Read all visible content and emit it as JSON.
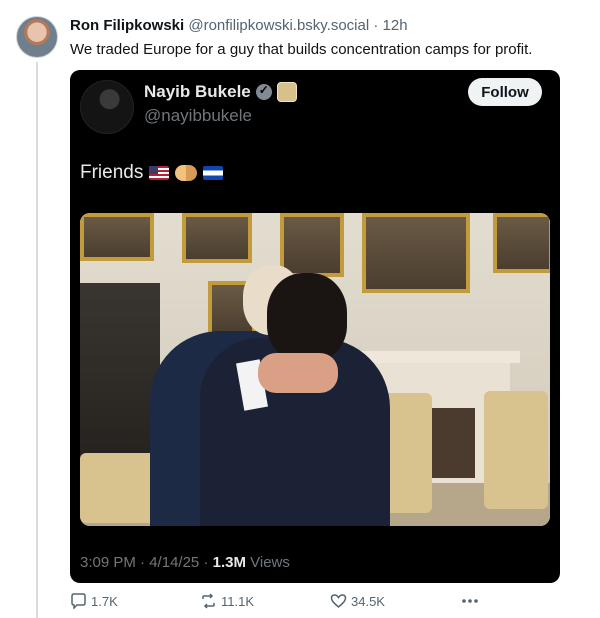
{
  "post": {
    "author_name": "Ron Filipkowski",
    "author_handle": "@ronfilipkowski.bsky.social",
    "separator": "·",
    "time_ago": "12h",
    "text": "We traded Europe for a guy that builds concentration camps for profit."
  },
  "embed": {
    "author_name": "Nayib Bukele",
    "author_handle": "@nayibbukele",
    "follow_label": "Follow",
    "text": "Friends",
    "time": "3:09 PM",
    "date": "4/14/25",
    "views_count": "1.3M",
    "views_label": "Views",
    "dot": "·"
  },
  "actions": {
    "replies": "1.7K",
    "reposts": "11.1K",
    "likes": "34.5K"
  },
  "colors": {
    "accent": "#1d9bf0",
    "embed_bg": "#000000",
    "muted": "#536471"
  },
  "icons": [
    "reply-icon",
    "repost-icon",
    "like-icon",
    "more-icon",
    "verified-icon"
  ]
}
